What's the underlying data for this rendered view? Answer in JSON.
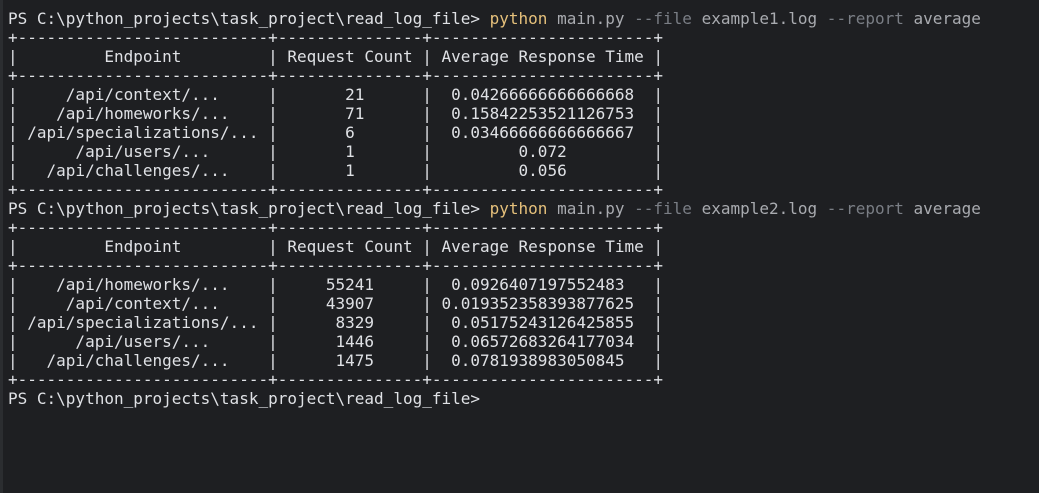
{
  "session": {
    "prompt": "PS C:\\python_projects\\task_project\\read_log_file> ",
    "runs": [
      {
        "command": "python",
        "script": " main.py",
        "flag_file": " --file",
        "file_value": " example1.log",
        "flag_report": " --report",
        "report_value": " average",
        "table": [
          "+--------------------------+---------------+-----------------------+",
          "|         Endpoint         | Request Count | Average Response Time |",
          "+--------------------------+---------------+-----------------------+",
          "|     /api/context/...     |       21      |  0.04266666666666668  |",
          "|    /api/homeworks/...    |       71      |  0.15842253521126753  |",
          "| /api/specializations/... |       6       |  0.03466666666666667  |",
          "|      /api/users/...      |       1       |         0.072         |",
          "|   /api/challenges/...    |       1       |         0.056         |",
          "+--------------------------+---------------+-----------------------+"
        ]
      },
      {
        "command": "python",
        "script": " main.py",
        "flag_file": " --file",
        "file_value": " example2.log",
        "flag_report": " --report",
        "report_value": " average",
        "table": [
          "+--------------------------+---------------+-----------------------+",
          "|         Endpoint         | Request Count | Average Response Time |",
          "+--------------------------+---------------+-----------------------+",
          "|    /api/homeworks/...    |     55241     |  0.0926407197552483   |",
          "|     /api/context/...     |     43907     | 0.019352358393877625  |",
          "| /api/specializations/... |      8329     |  0.05175243126425855  |",
          "|      /api/users/...      |      1446     |  0.06572683264177034  |",
          "|   /api/challenges/...    |      1475     |  0.0781938983050845   |",
          "+--------------------------+---------------+-----------------------+"
        ]
      }
    ],
    "final_prompt": "PS C:\\python_projects\\task_project\\read_log_file>"
  },
  "colors": {
    "background": "#1e1f22",
    "text": "#dfe1e5",
    "command": "#e5c07b",
    "flag": "#7a7e85"
  }
}
